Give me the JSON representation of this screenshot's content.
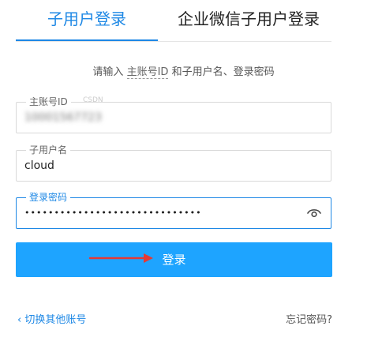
{
  "tabs": {
    "sub_user_login": "子用户登录",
    "enterprise_wechat_login": "企业微信子用户登录"
  },
  "hint": {
    "prefix": "请输入",
    "term": "主账号ID",
    "suffix": "和子用户名、登录密码"
  },
  "fields": {
    "main_account": {
      "label": "主账号ID",
      "value": "10001567723"
    },
    "username": {
      "label": "子用户名",
      "value": "cloud"
    },
    "password": {
      "label": "登录密码",
      "value": "••••••••••••••••••••••••••••••"
    }
  },
  "login_button": "登录",
  "links": {
    "switch_account": "切换其他账号",
    "forgot_password": "忘记密码?"
  },
  "colors": {
    "accent": "#1e88e5",
    "button": "#1ea4ff",
    "annotation_arrow": "#e53935"
  }
}
